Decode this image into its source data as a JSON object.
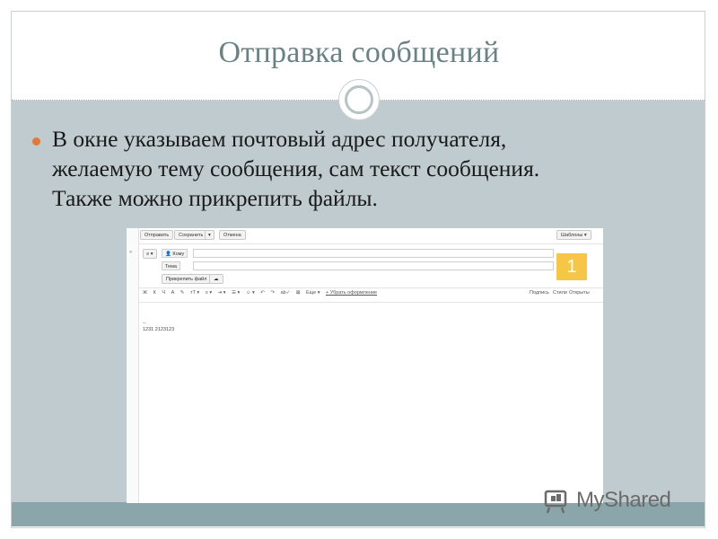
{
  "slide": {
    "title": "Отправка сообщений",
    "bullet_lines": [
      "В окне указываем почтовый адрес получателя,",
      "желаемую тему сообщения, сам текст сообщения.",
      "Также можно прикрепить файлы."
    ],
    "accent_color": "#e0793a",
    "title_color": "#6a8284",
    "panel_color": "#bfcbcf"
  },
  "mail": {
    "toolbar": {
      "send_label": "Отправить",
      "save_label": "Сохранить",
      "save_dropdown": "▾",
      "cancel_label": "Отмена",
      "templates_label": "Шаблоны ▾"
    },
    "compose": {
      "from_toggle": "≡ ▾",
      "to_label": "Кому",
      "subject_label": "Тема",
      "attach_label": "Прикрепить файл",
      "cloud_icon": "cloud-icon"
    },
    "badge": "1",
    "format_bar": {
      "items": [
        "Ж",
        "К",
        "Ч",
        "A",
        "✎",
        "тТ ▾",
        "≡ ▾",
        "⇥ ▾",
        "☰ ▾",
        "☺ ▾",
        "↶",
        "↷",
        "ab✓",
        "⊠",
        "Еще ▾",
        "+ Убрать оформление"
      ],
      "signature": "Подпись",
      "styles": "Стили",
      "open": "Открыты"
    },
    "editor_lines": [
      "--",
      "1231 2123123"
    ],
    "left_bar_mark": "«"
  },
  "watermark": {
    "text": "MyShared"
  }
}
